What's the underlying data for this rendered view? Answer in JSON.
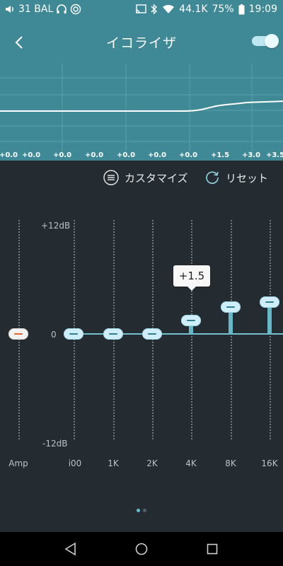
{
  "status_bar": {
    "left_text": "31 BAL",
    "bitrate": "44.1K",
    "battery": "75%",
    "time": "19:09",
    "icons": [
      "volume-icon",
      "headphones-icon",
      "app-notification-icon",
      "cast-icon",
      "bluetooth-icon",
      "wifi-icon",
      "battery-icon"
    ]
  },
  "header": {
    "title": "イコライザ",
    "back_icon": "chevron-left-icon",
    "toggle_on": true
  },
  "curve_values": [
    "+0.0",
    "+0.0",
    "+0.0",
    "+0.0",
    "+0.0",
    "+0.0",
    "+0.0",
    "+1.5",
    "+3.0",
    "+3.5"
  ],
  "actions": {
    "customize_label": "カスタマイズ",
    "customize_icon": "list-menu-icon",
    "reset_label": "リセット",
    "reset_icon": "refresh-icon"
  },
  "eq": {
    "scale_max": "+12dB",
    "scale_zero": "0",
    "scale_min": "-12dB",
    "tooltip": "+1.5",
    "bands": [
      {
        "label": "Amp",
        "value": 0.0
      },
      {
        "label": "i00",
        "value": 0.0
      },
      {
        "label": "1K",
        "value": 0.0
      },
      {
        "label": "2K",
        "value": 0.0
      },
      {
        "label": "4K",
        "value": 1.5
      },
      {
        "label": "8K",
        "value": 3.0
      },
      {
        "label": "16K",
        "value": 3.5
      }
    ],
    "range_db": [
      -12,
      12
    ]
  },
  "pager": {
    "count": 2,
    "active": 0
  },
  "colors": {
    "accent": "#3e8995",
    "background": "#252c31",
    "knob": "#cfeefa"
  },
  "nav_bar": {
    "icons": [
      "back-triangle-icon",
      "home-circle-icon",
      "recents-square-icon"
    ]
  }
}
